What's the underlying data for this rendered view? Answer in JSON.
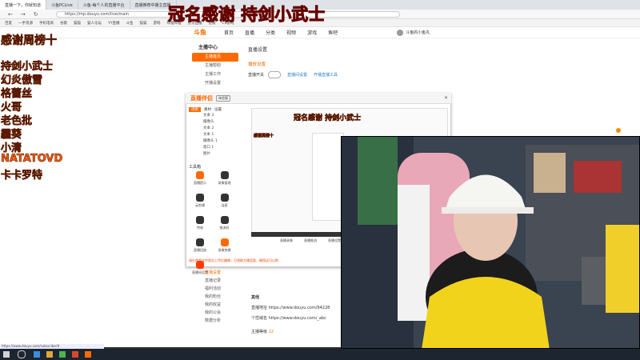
{
  "browser": {
    "tabs": [
      "直播一下，你就知道",
      "斗鱼PCLive",
      "斗鱼-每个人的直播平台",
      "直播推荐中播主直播"
    ],
    "url": "https://mp.douyu.com/live/main",
    "bookmarks": [
      "百度",
      "一手资源",
      "手机电商",
      "谷歌",
      "猫猫",
      "猫人论坛",
      "YY直播",
      "斗鱼",
      "猫猫",
      "游戏",
      "哔哩哔哩",
      "虎牙直播",
      "记账",
      "CS游戏",
      "百度云",
      "网文",
      "网游",
      "猫猫"
    ]
  },
  "overlay": {
    "banner": "冠名感谢 持剑小武士",
    "header": "感谢周榜十",
    "names": [
      "持剑小武士",
      "幻炎傲雪",
      "格蕾丝",
      "火哥",
      "老色批",
      "霾葵",
      "小清",
      "NATATOVD",
      "卡卡罗特"
    ]
  },
  "site": {
    "logo": "斗鱼",
    "nav": [
      "首页",
      "直播",
      "分类",
      "视频",
      "游戏",
      "鱼吧"
    ],
    "user": "斗鱼的小鱼丸",
    "left_menu_title": "主播中心",
    "left_menu": [
      "主播首页",
      "主播帮助",
      "主播工作",
      "开播设置"
    ],
    "content_title": "直播设置",
    "subtitle": "播放设置",
    "toggle_label": "直播开关",
    "links": [
      "直播间设置",
      "开播直播工具"
    ]
  },
  "obs": {
    "title": "直播伴侣",
    "badge": "体验版",
    "tabs": [
      "场景",
      "素材",
      "设置"
    ],
    "scenes": [
      "文本 3",
      "摄像头",
      "文本 2",
      "文本 1",
      "摄像头 1",
      "窗口 1",
      "图片"
    ],
    "tools_title": "工具箱",
    "tools": [
      "直播提示",
      "录像管理",
      "云剪辑",
      "连麦",
      "特效",
      "推流码",
      "直播回放",
      "录像剪辑",
      "直播间设置"
    ],
    "bottom_tools": [
      "直播录像",
      "直播推流",
      "直播设置"
    ],
    "notice": "请在视频文件首次上传后编辑，可领取主播奖励，确保这可以哟"
  },
  "lower": {
    "items": [
      "直播设置",
      "直播记录",
      "福利活动",
      "我的粉丝",
      "我的收益",
      "我的公会",
      "数据分析"
    ],
    "other_title": "其他",
    "live_url_label": "直播地址",
    "live_url": "https://www.douyu.com/94228",
    "personal_url_label": "个性域名",
    "personal_url": "https://www.douyu.com/_abc",
    "level_label": "主播等级",
    "level": "12"
  },
  "status_text": "https://www.douyu.com/subscribe/#",
  "colors": {
    "accent": "#ff6a00",
    "overlay": "#ff5a00",
    "banner": "#ff3c00"
  }
}
